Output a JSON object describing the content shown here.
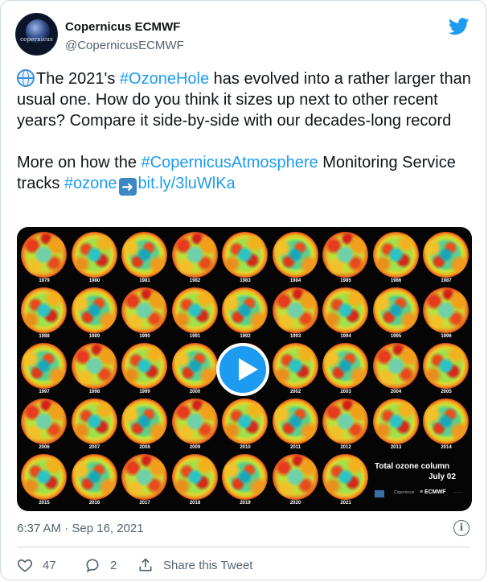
{
  "author": {
    "name": "Copernicus ECMWF",
    "handle": "@CopernicusECMWF",
    "avatar_text": "copernicus"
  },
  "tweet": {
    "line1_pre": "The 2021's ",
    "hashtag1": "#OzoneHole",
    "line1_post": " has evolved into a rather larger than usual one. How do you think it sizes up next to other recent years? Compare it side-by-side with our decades-long record",
    "p2_pre": "More on how the ",
    "hashtag2": "#CopernicusAtmosphere",
    "p2_mid": " Monitoring Service tracks ",
    "hashtag3": "#ozone",
    "link": "bit.ly/3luWlKa"
  },
  "video": {
    "years": [
      "1979",
      "1980",
      "1981",
      "1982",
      "1983",
      "1984",
      "1985",
      "1986",
      "1987",
      "1988",
      "1989",
      "1990",
      "1991",
      "1992",
      "1993",
      "1994",
      "1995",
      "1996",
      "1997",
      "1998",
      "1999",
      "2000",
      "2001",
      "2002",
      "2003",
      "2004",
      "2005",
      "2006",
      "2007",
      "2008",
      "2009",
      "2010",
      "2011",
      "2012",
      "2013",
      "2014",
      "2015",
      "2016",
      "2017",
      "2018",
      "2019",
      "2020",
      "2021"
    ],
    "caption_title": "Total ozone column",
    "caption_date": "July 02",
    "logo_cop": "Copernicus",
    "logo_ecmwf": "ECMWF",
    "logo_last": "·······"
  },
  "meta": {
    "timestamp": "6:37 AM · Sep 16, 2021",
    "info_symbol": "i"
  },
  "actions": {
    "likes": "47",
    "replies": "2",
    "share_label": "Share this Tweet"
  },
  "colors": {
    "accent": "#1d9bf0",
    "secondary_text": "#536471",
    "border": "#cfd9de"
  }
}
